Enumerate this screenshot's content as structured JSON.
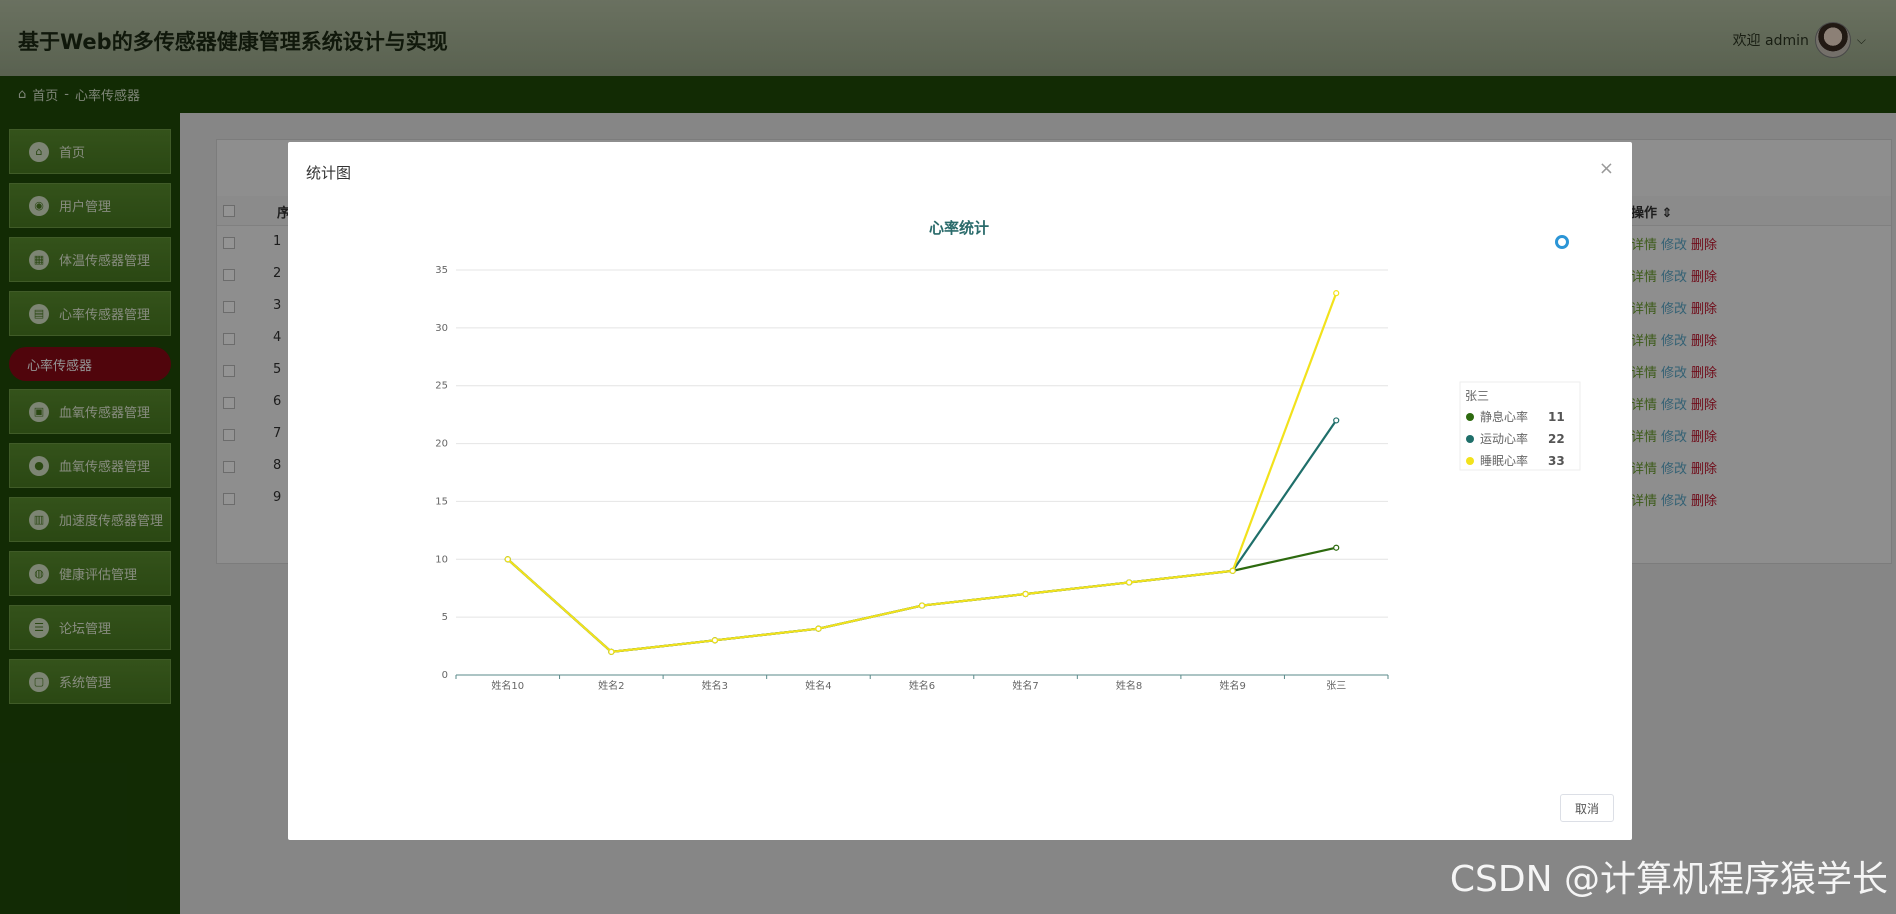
{
  "header": {
    "app_title": "基于Web的多传感器健康管理系统设计与实现",
    "welcome": "欢迎 admin",
    "caret": "⌵"
  },
  "breadcrumb": {
    "home": "首页",
    "separator": "-",
    "current": "心率传感器"
  },
  "sidebar": {
    "items": [
      {
        "label": "首页",
        "icon": "home-icon"
      },
      {
        "label": "用户管理",
        "icon": "user-icon"
      },
      {
        "label": "体温传感器管理",
        "icon": "grid-icon"
      },
      {
        "label": "心率传感器管理",
        "icon": "doc-icon"
      },
      {
        "label": "血氧传感器管理",
        "icon": "box-icon"
      },
      {
        "label": "血氧传感器管理",
        "icon": "record-icon"
      },
      {
        "label": "加速度传感器管理",
        "icon": "book-icon"
      },
      {
        "label": "健康评估管理",
        "icon": "globe-icon"
      },
      {
        "label": "论坛管理",
        "icon": "list-icon"
      },
      {
        "label": "系统管理",
        "icon": "lock-icon"
      }
    ],
    "active_sub": "心率传感器"
  },
  "table": {
    "header_prefix": "序",
    "op_header": "操作",
    "rows": [
      "1",
      "2",
      "3",
      "4",
      "5",
      "6",
      "7",
      "8",
      "9"
    ],
    "actions": {
      "detail": "详情",
      "edit": "修改",
      "delete": "删除"
    }
  },
  "modal": {
    "title": "统计图",
    "close": "×",
    "cancel": "取消"
  },
  "chart_data": {
    "type": "line",
    "title": "心率统计",
    "categories": [
      "姓名10",
      "姓名2",
      "姓名3",
      "姓名4",
      "姓名6",
      "姓名7",
      "姓名8",
      "姓名9",
      "张三"
    ],
    "ylim": [
      0,
      35
    ],
    "yticks": [
      0,
      5,
      10,
      15,
      20,
      25,
      30,
      35
    ],
    "grid": true,
    "series": [
      {
        "name": "静息心率",
        "color": "#2d6a0f",
        "values": [
          10,
          2,
          3,
          4,
          6,
          7,
          8,
          9,
          11
        ]
      },
      {
        "name": "运动心率",
        "color": "#1f6f6a",
        "values": [
          10,
          2,
          3,
          4,
          6,
          7,
          8,
          9,
          22
        ]
      },
      {
        "name": "睡眠心率",
        "color": "#f2e21c",
        "values": [
          10,
          2,
          3,
          4,
          6,
          7,
          8,
          9,
          33
        ]
      }
    ],
    "tooltip": {
      "name": "张三",
      "entries": [
        {
          "label": "静息心率",
          "value": "11"
        },
        {
          "label": "运动心率",
          "value": "22"
        },
        {
          "label": "睡眠心率",
          "value": "33"
        }
      ]
    }
  },
  "watermark": "CSDN @计算机程序猿学长"
}
